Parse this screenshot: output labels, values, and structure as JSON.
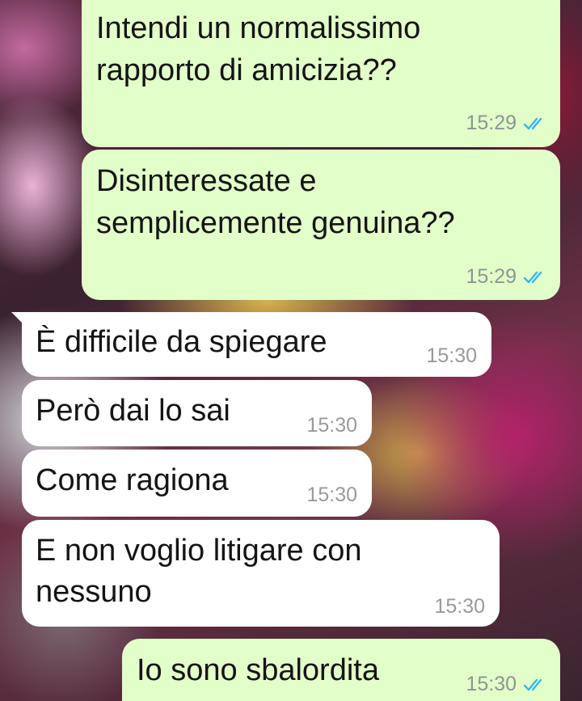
{
  "messages": [
    {
      "direction": "outgoing",
      "lines": [
        "Intendi un normalissimo",
        "rapporto di amicizia??"
      ],
      "time": "15:29",
      "status": "read-double-check"
    },
    {
      "direction": "outgoing",
      "lines": [
        "Disinteressate e",
        "semplicemente genuina??"
      ],
      "time": "15:29",
      "status": "read-double-check"
    },
    {
      "direction": "incoming",
      "lines": [
        "È difficile da spiegare"
      ],
      "time": "15:30"
    },
    {
      "direction": "incoming",
      "lines": [
        "Però dai lo sai"
      ],
      "time": "15:30"
    },
    {
      "direction": "incoming",
      "lines": [
        "Come ragiona"
      ],
      "time": "15:30"
    },
    {
      "direction": "incoming",
      "lines": [
        "E non voglio litigare con",
        "nessuno"
      ],
      "time": "15:30"
    },
    {
      "direction": "outgoing",
      "lines": [
        "Io sono sbalordita"
      ],
      "time": "15:30",
      "status": "read-double-check"
    }
  ],
  "colors": {
    "outgoing_bubble": "#e2fec9",
    "incoming_bubble": "#ffffff",
    "read_tick": "#34b7f1",
    "timestamp": "#8d9691"
  }
}
